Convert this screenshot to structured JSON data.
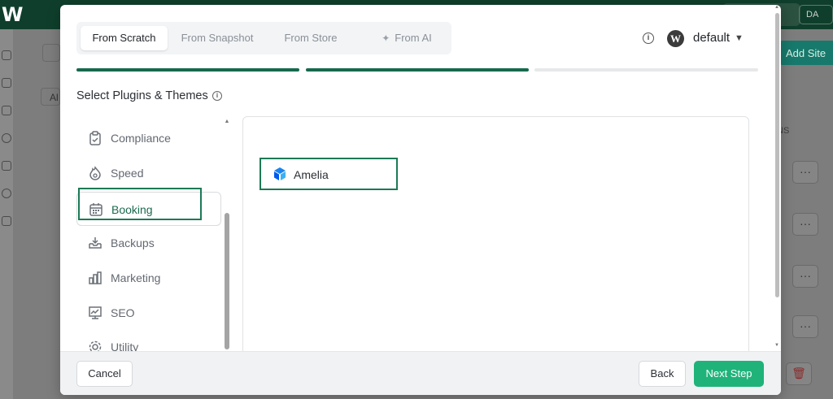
{
  "colors": {
    "accent": "#1fb37a",
    "brand_dark": "#0f3f2c",
    "highlight": "#1b7a55",
    "step_done": "#16694c",
    "step_todo": "#e6e8ea"
  },
  "background_app": {
    "user_initials": "DA",
    "add_site_label": "Add Site",
    "column_header_fragment": "NS",
    "filter_fragment": "Al"
  },
  "modal": {
    "tabs": [
      {
        "label": "From Scratch",
        "active": true
      },
      {
        "label": "From Snapshot",
        "active": false
      },
      {
        "label": "From Store",
        "active": false
      },
      {
        "label": "From AI",
        "active": false,
        "icon": "sparkle-icon"
      }
    ],
    "workspace_label": "default",
    "steps": [
      {
        "state": "done"
      },
      {
        "state": "done"
      },
      {
        "state": "todo"
      }
    ],
    "section_title": "Select Plugins & Themes",
    "categories": [
      {
        "label": "Compliance",
        "icon": "clipboard-check-icon",
        "active": false
      },
      {
        "label": "Speed",
        "icon": "speed-flame-icon",
        "active": false
      },
      {
        "label": "Booking",
        "icon": "calendar-icon",
        "active": true
      },
      {
        "label": "Backups",
        "icon": "backup-tray-icon",
        "active": false
      },
      {
        "label": "Marketing",
        "icon": "bar-chart-icon",
        "active": false
      },
      {
        "label": "SEO",
        "icon": "presentation-chart-icon",
        "active": false
      },
      {
        "label": "Utility",
        "icon": "gear-icon",
        "active": false
      }
    ],
    "plugins": [
      {
        "label": "Amelia",
        "icon": "amelia-logo-icon",
        "selected": true
      }
    ],
    "footer": {
      "cancel_label": "Cancel",
      "back_label": "Back",
      "next_label": "Next Step"
    }
  }
}
